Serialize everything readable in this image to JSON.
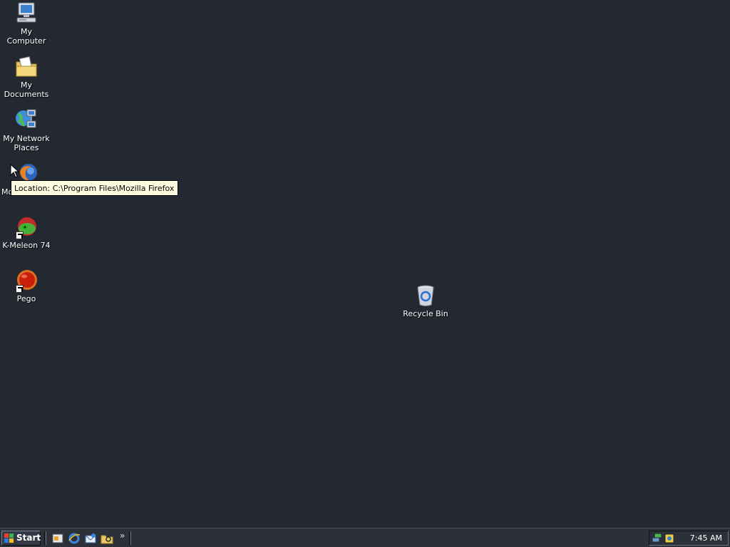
{
  "desktop": {
    "icons": [
      {
        "label": "My Computer",
        "icon": "computer-icon"
      },
      {
        "label": "My Documents",
        "icon": "folder-documents-icon"
      },
      {
        "label": "My Network Places",
        "icon": "network-icon"
      },
      {
        "label": "Mo",
        "icon": "firefox-icon"
      },
      {
        "label": "K-Meleon 74",
        "icon": "k-meleon-icon"
      },
      {
        "label": "Pego",
        "icon": "pego-icon"
      },
      {
        "label": "Recycle Bin",
        "icon": "recycle-bin-icon"
      }
    ]
  },
  "tooltip": {
    "text": "Location: C:\\Program Files\\Mozilla Firefox"
  },
  "taskbar": {
    "start_label": "Start",
    "quick_launch": [
      "desktop-icon",
      "internet-explorer-icon",
      "outlook-icon",
      "windows-explorer-icon"
    ],
    "overflow_glyph": "»",
    "tray_icons": [
      "network-tray-icon",
      "volume-tray-icon"
    ],
    "clock": "7:45 AM"
  },
  "colors": {
    "desktop_bg": "#232831",
    "taskbar_bg": "#2b3039",
    "tooltip_bg": "#ffffe1"
  }
}
